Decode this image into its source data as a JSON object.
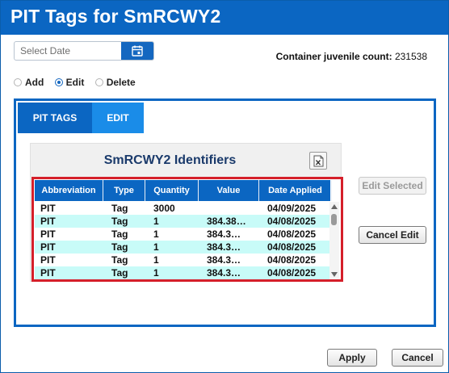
{
  "window": {
    "title": "PIT Tags for SmRCWY2"
  },
  "date_picker": {
    "placeholder": "Select Date",
    "icon": "calendar-icon"
  },
  "container_count": {
    "label": "Container juvenile count:",
    "value": "231538"
  },
  "mode": {
    "options": [
      {
        "label": "Add",
        "checked": false
      },
      {
        "label": "Edit",
        "checked": true
      },
      {
        "label": "Delete",
        "checked": false
      }
    ]
  },
  "tabs": [
    {
      "label": "PIT TAGS",
      "active": false
    },
    {
      "label": "EDIT",
      "active": true
    }
  ],
  "identifiers": {
    "title": "SmRCWY2 Identifiers",
    "export_icon": "excel-export-icon",
    "columns": [
      "Abbreviation",
      "Type",
      "Quantity",
      "Value",
      "Date Applied"
    ],
    "rows": [
      [
        "PIT",
        "Tag",
        "3000",
        "",
        "04/09/2025"
      ],
      [
        "PIT",
        "Tag",
        "1",
        "384.38…",
        "04/08/2025"
      ],
      [
        "PIT",
        "Tag",
        "1",
        "384.3…",
        "04/08/2025"
      ],
      [
        "PIT",
        "Tag",
        "1",
        "384.3…",
        "04/08/2025"
      ],
      [
        "PIT",
        "Tag",
        "1",
        "384.3…",
        "04/08/2025"
      ],
      [
        "PIT",
        "Tag",
        "1",
        "384.3…",
        "04/08/2025"
      ]
    ]
  },
  "buttons": {
    "edit_selected": "Edit Selected",
    "cancel_edit": "Cancel Edit",
    "apply": "Apply",
    "cancel": "Cancel"
  },
  "colors": {
    "primary": "#0b66c2",
    "active_tab": "#1a8ce8",
    "selection_border": "#d51f2a",
    "alt_row": "#c8fbf8"
  }
}
